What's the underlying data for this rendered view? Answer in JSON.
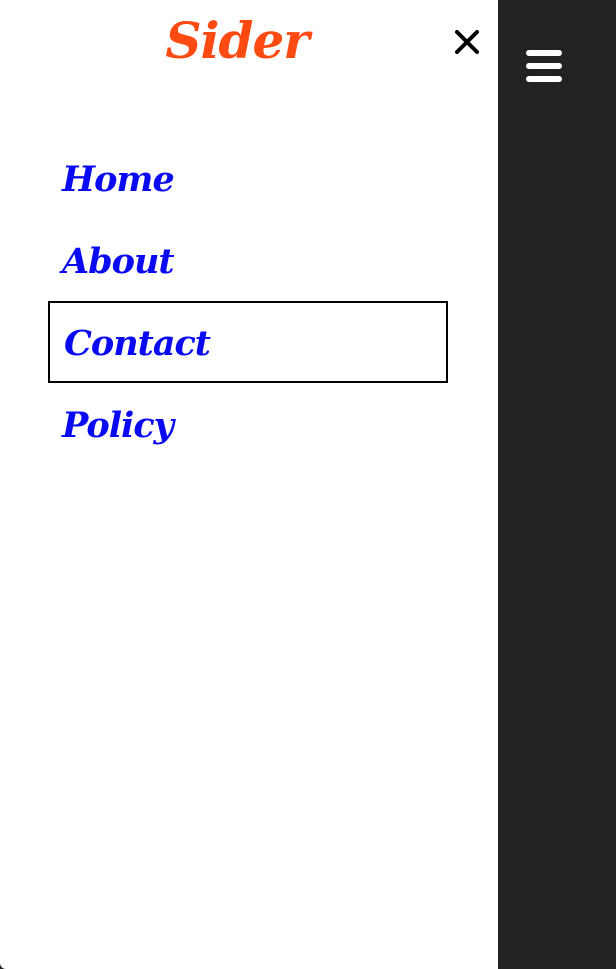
{
  "brand": {
    "title": "Sider",
    "color": "#ff4b12"
  },
  "sider": {
    "close_icon": "close-icon",
    "nav_color": "#0a0af2",
    "items": [
      {
        "label": "Home"
      },
      {
        "label": "About"
      },
      {
        "label": "Contact",
        "focused": true
      },
      {
        "label": "Policy"
      }
    ]
  },
  "main": {
    "background": "#222222",
    "menu_icon": "hamburger-menu-icon"
  }
}
